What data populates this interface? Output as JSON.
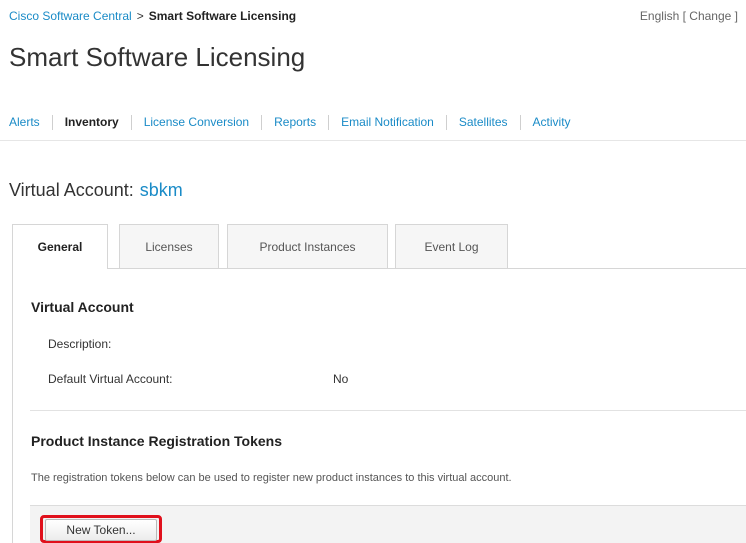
{
  "header": {
    "breadcrumb": {
      "root_label": "Cisco Software Central",
      "separator": ">",
      "current_label": "Smart Software Licensing"
    },
    "language": {
      "current": "English",
      "change_label": "[ Change ]"
    }
  },
  "page": {
    "title": "Smart Software Licensing"
  },
  "nav": {
    "items": [
      {
        "label": "Alerts"
      },
      {
        "label": "Inventory",
        "active": true
      },
      {
        "label": "License Conversion"
      },
      {
        "label": "Reports"
      },
      {
        "label": "Email Notification"
      },
      {
        "label": "Satellites"
      },
      {
        "label": "Activity"
      }
    ]
  },
  "virtual_account": {
    "heading_label": "Virtual Account:",
    "name": "sbkm"
  },
  "tabs": {
    "items": [
      {
        "label": "General",
        "active": true
      },
      {
        "label": "Licenses"
      },
      {
        "label": "Product Instances"
      },
      {
        "label": "Event Log"
      }
    ]
  },
  "general": {
    "section_title": "Virtual Account",
    "description_label": "Description:",
    "description_value": "",
    "default_label": "Default Virtual Account:",
    "default_value": "No"
  },
  "tokens": {
    "section_title": "Product Instance Registration Tokens",
    "description": "The registration tokens below can be used to register new product instances to this virtual account.",
    "new_token_label": "New Token..."
  },
  "colors": {
    "link": "#1a8bc7",
    "highlight": "#e0101c"
  }
}
